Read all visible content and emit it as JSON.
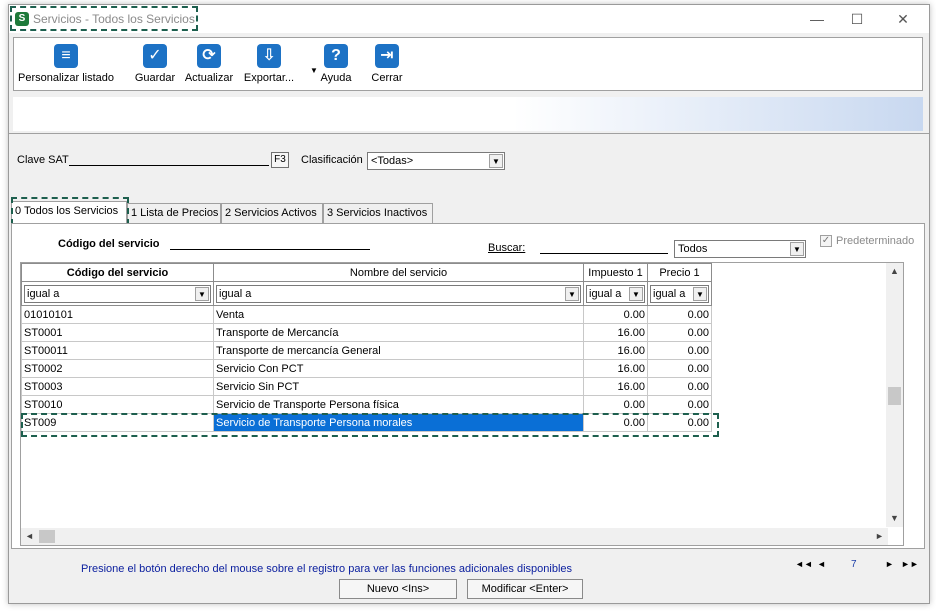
{
  "window": {
    "title": "Servicios - Todos los Servicios",
    "icon_letter": "S",
    "controls": [
      "—",
      "☐",
      "✕"
    ]
  },
  "toolbar": {
    "buttons": [
      {
        "label": "Personalizar listado",
        "icon": "list-icon"
      },
      {
        "label": "Guardar",
        "icon": "checkmark-icon"
      },
      {
        "label": "Actualizar",
        "icon": "refresh-icon"
      },
      {
        "label": "Exportar...",
        "icon": "export-icon"
      },
      {
        "label": "Ayuda",
        "icon": "help-icon"
      },
      {
        "label": "Cerrar",
        "icon": "exit-icon"
      }
    ]
  },
  "filter": {
    "clave_sat_label": "Clave SAT",
    "f3_label": "F3",
    "clasificacion_label": "Clasificación",
    "clasificacion_value": "<Todas>"
  },
  "tabs": [
    "0 Todos los Servicios",
    "1 Lista de Precios",
    "2 Servicios Activos",
    "3 Servicios Inactivos"
  ],
  "search": {
    "codigo_label": "Código del servicio",
    "buscar_label": "Buscar:",
    "scope_value": "Todos",
    "predeterminado_label": "Predeterminado",
    "predeterminado_checked": true
  },
  "grid": {
    "columns": [
      "Código del servicio",
      "Nombre del servicio",
      "Impuesto 1",
      "Precio 1"
    ],
    "filters": [
      "igual a",
      "igual a",
      "igual a",
      "igual a"
    ],
    "rows": [
      [
        "01010101",
        "Venta",
        "0.00",
        "0.00"
      ],
      [
        "ST0001",
        "Transporte de Mercancía",
        "16.00",
        "0.00"
      ],
      [
        "ST00011",
        "Transporte de mercancía General",
        "16.00",
        "0.00"
      ],
      [
        "ST0002",
        "Servicio Con PCT",
        "16.00",
        "0.00"
      ],
      [
        "ST0003",
        "Servicio Sin PCT",
        "16.00",
        "0.00"
      ],
      [
        "ST0010",
        "Servicio de Transporte Persona física",
        "0.00",
        "0.00"
      ],
      [
        "ST009",
        "Servicio de Transporte Persona morales",
        "0.00",
        "0.00"
      ]
    ],
    "selected_row": 6
  },
  "status": {
    "hint": "Presione el botón derecho del mouse sobre el registro para ver las funciones adicionales disponibles",
    "page": "7",
    "nav_first": "◄◄",
    "nav_prev": "◄",
    "nav_next": "►",
    "nav_last": "►►",
    "new_button": "Nuevo <Ins>",
    "edit_button": "Modificar <Enter>"
  },
  "colors": {
    "selection": "#0a6fd6",
    "highlight_border": "#1d5f4e",
    "hint_text": "#0a1e9e",
    "toolbar_icon": "#1d72c5"
  }
}
